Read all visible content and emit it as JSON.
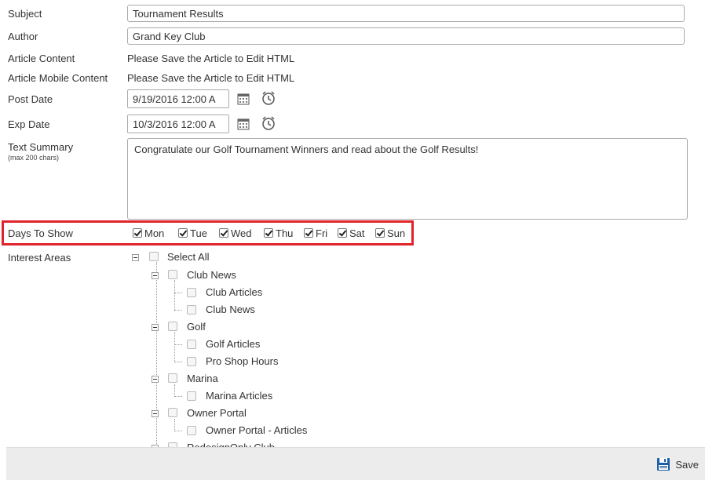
{
  "form": {
    "subject_label": "Subject",
    "subject_value": "Tournament Results",
    "author_label": "Author",
    "author_value": "Grand Key Club",
    "article_content_label": "Article Content",
    "article_content_value": "Please Save the Article to Edit HTML",
    "article_mobile_label": "Article Mobile Content",
    "article_mobile_value": "Please Save the Article to Edit HTML",
    "post_date_label": "Post Date",
    "post_date_value": "9/19/2016 12:00 A",
    "exp_date_label": "Exp Date",
    "exp_date_value": "10/3/2016 12:00 A",
    "summary_label": "Text Summary",
    "summary_hint": "(max 200 chars)",
    "summary_value": "Congratulate our Golf Tournament Winners and read about the Golf Results!",
    "days_label": "Days To Show",
    "days": [
      {
        "label": "Mon",
        "checked": true
      },
      {
        "label": "Tue",
        "checked": true
      },
      {
        "label": "Wed",
        "checked": true
      },
      {
        "label": "Thu",
        "checked": true
      },
      {
        "label": "Fri",
        "checked": true
      },
      {
        "label": "Sat",
        "checked": true
      },
      {
        "label": "Sun",
        "checked": true
      }
    ],
    "interest_label": "Interest Areas"
  },
  "tree": {
    "select_all": "Select All",
    "club_news": "Club News",
    "club_articles": "Club Articles",
    "club_news_child": "Club News",
    "golf": "Golf",
    "golf_articles": "Golf Articles",
    "pro_shop_hours": "Pro Shop Hours",
    "marina": "Marina",
    "marina_articles": "Marina Articles",
    "owner_portal": "Owner Portal",
    "owner_portal_articles": "Owner Portal - Articles",
    "redesign_only_club": "RedesignOnly Club"
  },
  "footer": {
    "save_label": "Save"
  },
  "colors": {
    "highlight": "#e0242c",
    "save_icon": "#1f5fa8"
  }
}
